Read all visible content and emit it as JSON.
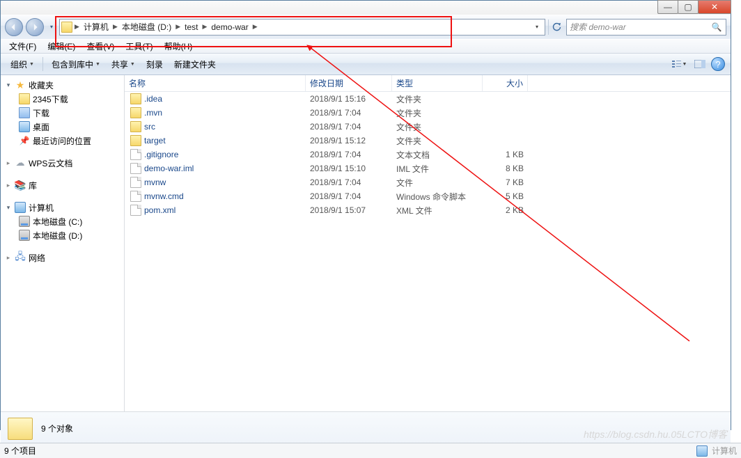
{
  "window": {
    "controls": {
      "min": "—",
      "max": "▢",
      "close": "✕"
    }
  },
  "breadcrumb": [
    "计算机",
    "本地磁盘 (D:)",
    "test",
    "demo-war"
  ],
  "search": {
    "placeholder": "搜索 demo-war"
  },
  "menubar": [
    {
      "k": "file",
      "label": "文件(F)"
    },
    {
      "k": "edit",
      "label": "编辑(E)"
    },
    {
      "k": "view",
      "label": "查看(V)"
    },
    {
      "k": "tools",
      "label": "工具(T)"
    },
    {
      "k": "help",
      "label": "帮助(H)"
    }
  ],
  "toolbar": {
    "organize": "组织",
    "include": "包含到库中",
    "share": "共享",
    "burn": "刻录",
    "newfolder": "新建文件夹"
  },
  "sidebar": {
    "favorites": {
      "label": "收藏夹",
      "items": [
        {
          "k": "2345dl",
          "label": "2345下载",
          "ico": "fold-y"
        },
        {
          "k": "dl",
          "label": "下载",
          "ico": "fold-b"
        },
        {
          "k": "desk",
          "label": "桌面",
          "ico": "mon"
        },
        {
          "k": "recent",
          "label": "最近访问的位置",
          "ico": "pin"
        }
      ]
    },
    "wps": {
      "label": "WPS云文档"
    },
    "library": {
      "label": "库"
    },
    "computer": {
      "label": "计算机",
      "items": [
        {
          "k": "c",
          "label": "本地磁盘 (C:)"
        },
        {
          "k": "d",
          "label": "本地磁盘 (D:)"
        }
      ]
    },
    "network": {
      "label": "网络"
    }
  },
  "columns": {
    "name": "名称",
    "date": "修改日期",
    "type": "类型",
    "size": "大小"
  },
  "files": [
    {
      "name": ".idea",
      "date": "2018/9/1 15:16",
      "type": "文件夹",
      "size": "",
      "ico": "fold"
    },
    {
      "name": ".mvn",
      "date": "2018/9/1 7:04",
      "type": "文件夹",
      "size": "",
      "ico": "fold"
    },
    {
      "name": "src",
      "date": "2018/9/1 7:04",
      "type": "文件夹",
      "size": "",
      "ico": "fold"
    },
    {
      "name": "target",
      "date": "2018/9/1 15:12",
      "type": "文件夹",
      "size": "",
      "ico": "fold"
    },
    {
      "name": ".gitignore",
      "date": "2018/9/1 7:04",
      "type": "文本文档",
      "size": "1 KB",
      "ico": "file"
    },
    {
      "name": "demo-war.iml",
      "date": "2018/9/1 15:10",
      "type": "IML 文件",
      "size": "8 KB",
      "ico": "file"
    },
    {
      "name": "mvnw",
      "date": "2018/9/1 7:04",
      "type": "文件",
      "size": "7 KB",
      "ico": "file"
    },
    {
      "name": "mvnw.cmd",
      "date": "2018/9/1 7:04",
      "type": "Windows 命令脚本",
      "size": "5 KB",
      "ico": "file"
    },
    {
      "name": "pom.xml",
      "date": "2018/9/1 15:07",
      "type": "XML 文件",
      "size": "2 KB",
      "ico": "file"
    }
  ],
  "details": {
    "count": "9 个对象"
  },
  "status": {
    "items": "9 个项目",
    "location": "计算机"
  },
  "watermark": "https://blog.csdn.hu.05LCTO博客"
}
